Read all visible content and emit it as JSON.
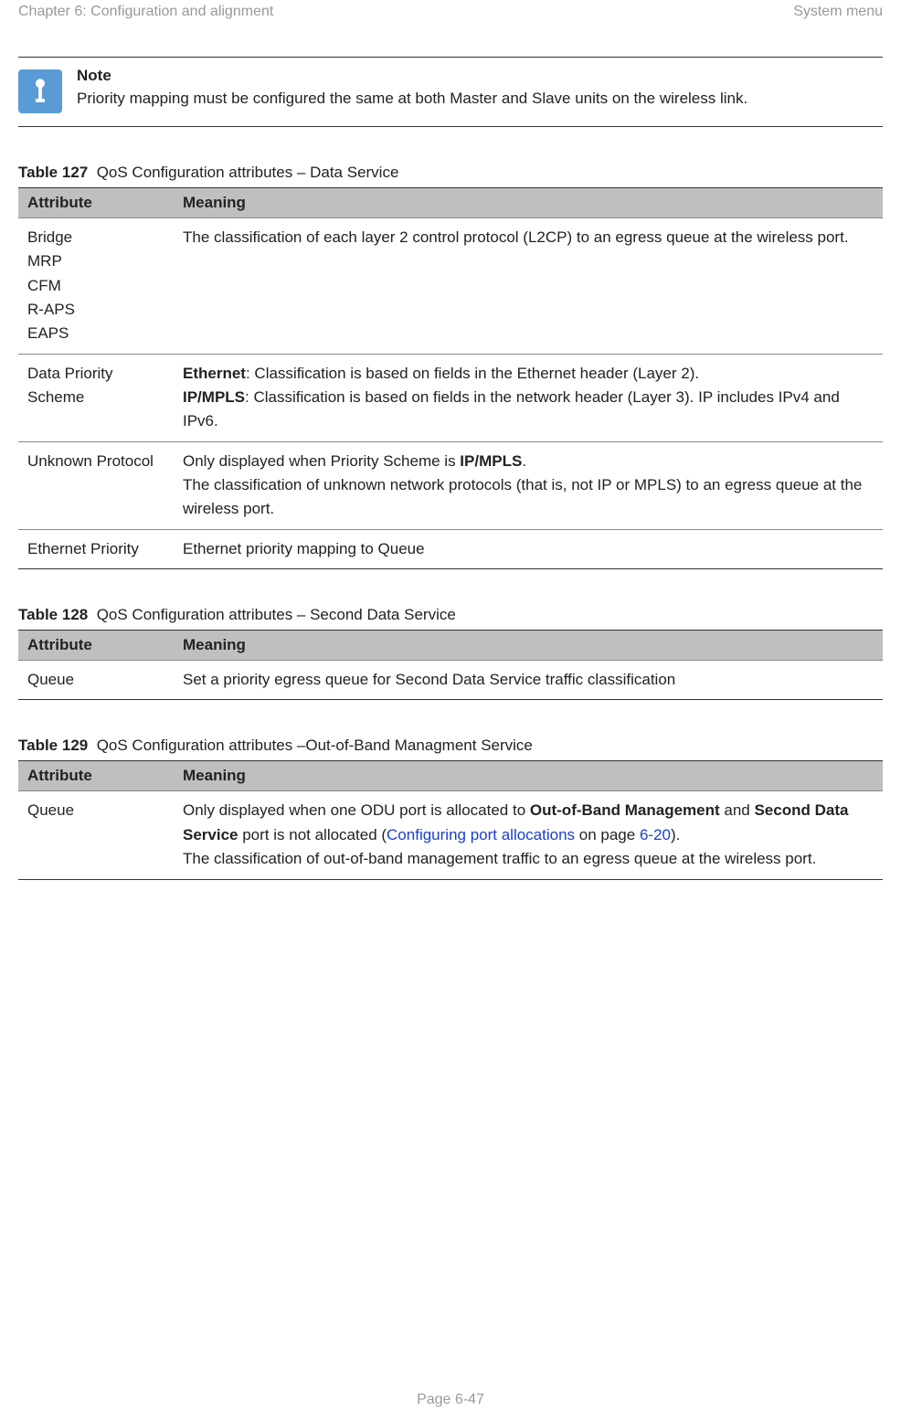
{
  "header": {
    "left": "Chapter 6:  Configuration and alignment",
    "right": "System menu"
  },
  "note": {
    "title": "Note",
    "body": "Priority mapping must be configured the same at both Master and Slave units on the wireless link."
  },
  "tables": {
    "t127": {
      "label": "Table 127",
      "caption": "QoS Configuration attributes – Data Service",
      "col_attr": "Attribute",
      "col_meaning": "Meaning",
      "rows": {
        "r0": {
          "a1": "Bridge",
          "a2": "MRP",
          "a3": "CFM",
          "a4": "R-APS",
          "a5": "EAPS",
          "meaning": "The classification of each layer 2 control protocol (L2CP) to an egress queue at the wireless port."
        },
        "r1": {
          "attr": "Data Priority Scheme",
          "eth_b": "Ethernet",
          "eth_rest": ": Classification is based on fields in the Ethernet header (Layer 2).",
          "ip_b": "IP/MPLS",
          "ip_rest": ": Classification is based on fields in the network header (Layer 3). IP includes IPv4 and IPv6."
        },
        "r2": {
          "attr": "Unknown Protocol",
          "line1_pre": "Only displayed when Priority Scheme is ",
          "line1_b": "IP/MPLS",
          "line1_post": ".",
          "line2": "The classification of unknown network protocols (that is, not IP or MPLS) to an egress queue at the wireless port."
        },
        "r3": {
          "attr": "Ethernet Priority",
          "meaning": "Ethernet priority mapping to Queue"
        }
      }
    },
    "t128": {
      "label": "Table 128",
      "caption": "QoS Configuration attributes – Second Data Service",
      "col_attr": "Attribute",
      "col_meaning": "Meaning",
      "rows": {
        "r0": {
          "attr": "Queue",
          "meaning": "Set a priority egress queue for Second Data Service traffic classification"
        }
      }
    },
    "t129": {
      "label": "Table 129",
      "caption": "QoS Configuration attributes –Out-of-Band Managment Service",
      "col_attr": "Attribute",
      "col_meaning": "Meaning",
      "rows": {
        "r0": {
          "attr": "Queue",
          "p1_pre": "Only displayed when one ODU port is allocated to ",
          "p1_b1": "Out-of-Band Management",
          "p1_mid": " and ",
          "p1_b2": "Second Data Service",
          "p1_post1": " port is not allocated (",
          "p1_link1": "Configuring port allocations",
          "p1_post2": " on page ",
          "p1_link2": "6-20",
          "p1_post3": ").",
          "p2": "The classification of out-of-band management traffic to an egress queue at the wireless port."
        }
      }
    }
  },
  "footer": "Page 6-47"
}
